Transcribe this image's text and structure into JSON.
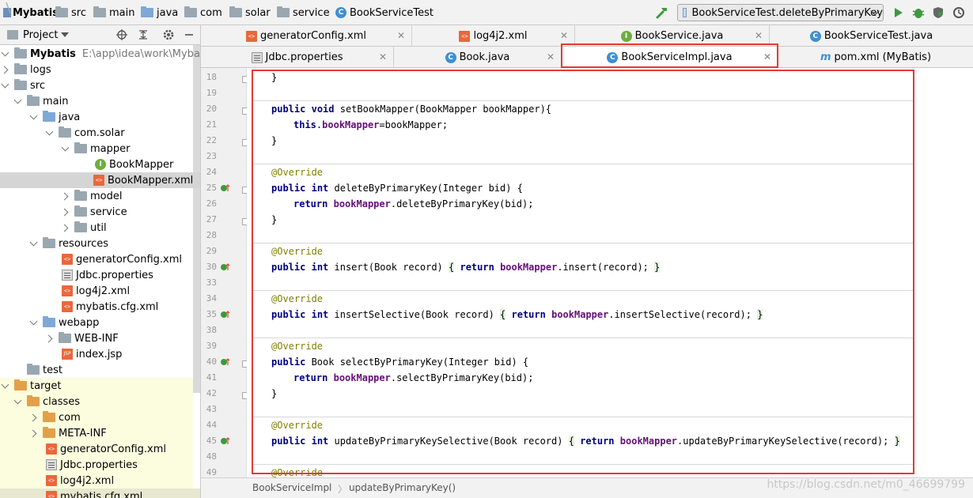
{
  "nav": {
    "crumbs": [
      "Mybatis",
      "src",
      "main",
      "java",
      "com",
      "solar",
      "service",
      "BookServiceTest"
    ],
    "run_config": "BookServiceTest.deleteByPrimaryKey"
  },
  "project": {
    "title": "Project",
    "root_name": "Mybatis",
    "root_path": "E:\\app\\idea\\work\\Mybatis",
    "tree": [
      "logs",
      "src",
      "main",
      "java",
      "com.solar",
      "mapper",
      "BookMapper",
      "BookMapper.xml",
      "model",
      "service",
      "util",
      "resources",
      "generatorConfig.xml",
      "Jdbc.properties",
      "log4j2.xml",
      "mybatis.cfg.xml",
      "webapp",
      "WEB-INF",
      "index.jsp",
      "test",
      "target",
      "classes",
      "com",
      "META-INF",
      "generatorConfig.xml",
      "Jdbc.properties",
      "log4j2.xml",
      "mybatis.cfg.xml"
    ]
  },
  "tabs": {
    "row1": [
      "generatorConfig.xml",
      "log4j2.xml",
      "BookService.java",
      "BookServiceTest.java"
    ],
    "row2": [
      "Jdbc.properties",
      "Book.java",
      "BookServiceImpl.java",
      "pom.xml (MyBatis)"
    ]
  },
  "code": {
    "line_numbers": [
      "18",
      "19",
      "20",
      "21",
      "22",
      "23",
      "24",
      "25",
      "26",
      "27",
      "28",
      "29",
      "30",
      "33",
      "34",
      "35",
      "38",
      "39",
      "40",
      "41",
      "42",
      "43",
      "44",
      "45",
      "48",
      "49"
    ],
    "override": "@Override",
    "public": "public",
    "void": "void",
    "int": "int",
    "this": "this",
    "return": "return",
    "field": "bookMapper",
    "set_sig": " setBookMapper(BookMapper bookMapper){",
    "assign": "=bookMapper;",
    "delete_sig": " deleteByPrimaryKey(Integer bid) {",
    "delete_call": ".deleteByPrimaryKey(bid);",
    "insert_sig": " insert(Book record) ",
    "insert_call": ".insert(record); ",
    "insert_sel_sig": " insertSelective(Book record) ",
    "insert_sel_call": ".insertSelective(record); ",
    "select_sig": " Book selectByPrimaryKey(Integer bid) {",
    "select_call": ".selectByPrimaryKey(bid);",
    "update_sig": " updateByPrimaryKeySelective(Book record) ",
    "update_call": ".updateByPrimaryKeySelective(record); ",
    "open_brace": "{",
    "close_brace": "}"
  },
  "status": {
    "class_crumb": "BookServiceImpl",
    "method_crumb": "updateByPrimaryKey()",
    "watermark": "https://blog.csdn.net/m0_46699799"
  },
  "colors": {
    "highlight_border": "#e53935",
    "keyword": "#000080",
    "annotation": "#808000",
    "field": "#660e7a"
  }
}
